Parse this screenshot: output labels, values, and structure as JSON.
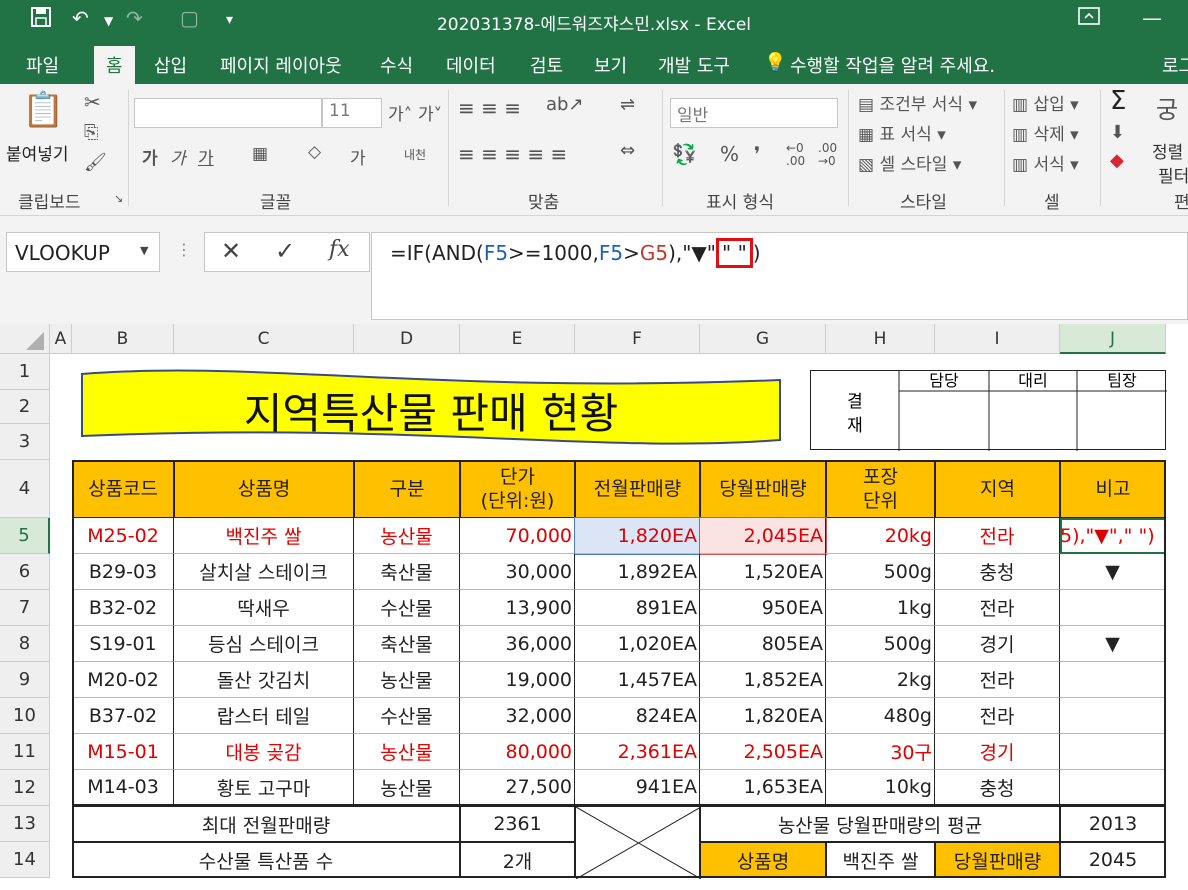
{
  "window": {
    "title": "202031378-에드워즈쟈스민.xlsx  -  Excel"
  },
  "tabs": [
    {
      "label": "파일"
    },
    {
      "label": "홈"
    },
    {
      "label": "삽입"
    },
    {
      "label": "페이지 레이아웃"
    },
    {
      "label": "수식"
    },
    {
      "label": "데이터"
    },
    {
      "label": "검토"
    },
    {
      "label": "보기"
    },
    {
      "label": "개발 도구"
    },
    {
      "label": "수행할 작업을 알려 주세요."
    },
    {
      "label": "로그"
    }
  ],
  "ribbon": {
    "paste": "붙여넣기",
    "font_size": "11",
    "number_format": "일반",
    "groups": {
      "clipboard": "클립보드",
      "font": "글꼴",
      "align": "맞춤",
      "number": "표시 형식",
      "style": "스타일",
      "cells": "셀",
      "edit": "편"
    },
    "style_items": [
      "조건부 서식",
      "표 서식",
      "셀 스타일"
    ],
    "cell_items": [
      "삽입",
      "삭제",
      "서식"
    ],
    "edit_items": [
      "정렬",
      "필터"
    ],
    "font_btns": [
      "가",
      "가",
      "가"
    ],
    "wrap": "내천"
  },
  "formula": {
    "namebox": "VLOOKUP",
    "pre": "=IF(AND(",
    "r1": "F5",
    ">": ">=1000,",
    "r2": "F5",
    "gt": ">",
    "r3": "G5",
    "post": "),\"▼\"",
    "boxed": "\" \"",
    "end": ")"
  },
  "columns": [
    "A",
    "B",
    "C",
    "D",
    "E",
    "F",
    "G",
    "H",
    "I",
    "J"
  ],
  "rows": [
    "1",
    "2",
    "3",
    "4",
    "5",
    "6",
    "7",
    "8",
    "9",
    "10",
    "11",
    "12",
    "13",
    "14"
  ],
  "banner": "지역특산물 판매 현황",
  "approval": {
    "label1": "결",
    "label2": "재",
    "h1": "담당",
    "h2": "대리",
    "h3": "팀장"
  },
  "headers": [
    "상품코드",
    "상품명",
    "구분",
    "단가\n(단위:원)",
    "전월판매량",
    "당월판매량",
    "포장\n단위",
    "지역",
    "비고"
  ],
  "data": [
    [
      "M25-02",
      "백진주 쌀",
      "농산물",
      "70,000",
      "1,820EA",
      "2,045EA",
      "20kg",
      "전라",
      "5),\"▼\",\" \")"
    ],
    [
      "B29-03",
      "살치살 스테이크",
      "축산물",
      "30,000",
      "1,892EA",
      "1,520EA",
      "500g",
      "충청",
      "▼"
    ],
    [
      "B32-02",
      "딱새우",
      "수산물",
      "13,900",
      "891EA",
      "950EA",
      "1kg",
      "전라",
      ""
    ],
    [
      "S19-01",
      "등심 스테이크",
      "축산물",
      "36,000",
      "1,020EA",
      "805EA",
      "500g",
      "경기",
      "▼"
    ],
    [
      "M20-02",
      "돌산 갓김치",
      "농산물",
      "19,000",
      "1,457EA",
      "1,852EA",
      "2kg",
      "전라",
      ""
    ],
    [
      "B37-02",
      "랍스터 테일",
      "수산물",
      "32,000",
      "824EA",
      "1,820EA",
      "480g",
      "전라",
      ""
    ],
    [
      "M15-01",
      "대봉 곶감",
      "농산물",
      "80,000",
      "2,361EA",
      "2,505EA",
      "30구",
      "경기",
      ""
    ],
    [
      "M14-03",
      "황토 고구마",
      "농산물",
      "27,500",
      "941EA",
      "1,653EA",
      "10kg",
      "충청",
      ""
    ]
  ],
  "red_rows": [
    0,
    6
  ],
  "summary": {
    "r13_label": "최대 전월판매량",
    "r13_val": "2361",
    "r14_label": "수산물 특산품 수",
    "r14_val": "2개",
    "avg_label": "농산물 당월판매량의 평균",
    "avg_val": "2013",
    "name_label": "상품명",
    "name_val": "백진주 쌀",
    "cur_label": "당월판매량",
    "cur_val": "2045"
  },
  "colors": {
    "accent": "#217346",
    "header_fill": "#ffc000",
    "banner_fill": "#ffff00",
    "red": "#e00000"
  }
}
